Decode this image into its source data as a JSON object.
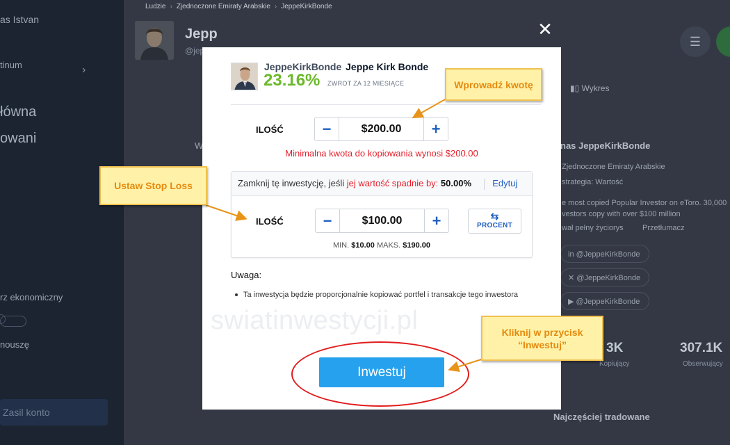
{
  "background": {
    "sidebar": {
      "user_name": "as Istvan",
      "club": "tinum",
      "menu_main": "łówna",
      "menu_watch": "owani",
      "economic": "rz ekonomiczny",
      "invite": "nouszę",
      "deposit_button": "Zasil konto"
    },
    "breadcrumb": [
      "Ludzie",
      "Zjednoczone Emiraty Arabskie",
      "JeppeKirkBonde"
    ],
    "profile_name": "Jepp",
    "profile_handle": "@jep",
    "left_card_letter": "W",
    "chart_tab": "Wykres",
    "right_panel": {
      "title": "nas JeppeKirkBonde",
      "country": "Zjednoczone Emiraty Arabskie",
      "strategy": "strategia: Wartość",
      "bio_1": "e most copied Popular Investor on eToro. 30,000",
      "bio_2": "vestors copy with over $100 million",
      "links": "wał pełny życiorys",
      "links_2": "Przetłumacz",
      "social": [
        "@JeppeKirkBonde",
        "@JeppeKirkBonde",
        "@JeppeKirkBonde"
      ]
    },
    "stats": [
      {
        "value": "3K",
        "label": "Kopiujący"
      },
      {
        "value": "307.1K",
        "label": "Obserwujący"
      }
    ],
    "bottom_title": "Najczęściej tradowane"
  },
  "modal": {
    "close_icon": "close-icon",
    "investor_handle": "JeppeKirkBonde",
    "investor_name": "Jeppe Kirk Bonde",
    "return_value": "23.16%",
    "return_label": "ZWROT ZA 12 MIESIĄCE",
    "amount_label": "ILOŚĆ",
    "amount_value": "$200.00",
    "min_warning": "Minimalna kwota do kopiowania wynosi $200.00",
    "stop_loss": {
      "text_prefix": "Zamknij tę inwestycję, jeśli",
      "text_red": "jej wartość spadnie by:",
      "percent": "50.00%",
      "edit_link": "Edytuj",
      "amount_label": "ILOŚĆ",
      "amount_value": "$100.00",
      "mode_button": "PROCENT",
      "min_label": "MIN.",
      "min_value": "$10.00",
      "max_label": "MAKS.",
      "max_value": "$190.00"
    },
    "note_title": "Uwaga:",
    "note_item": "Ta inwestycja będzie proporcjonalnie kopiować portfel i transakcje tego inwestora",
    "watermark": "swiatinwestycji.pl",
    "invest_button": "Inwestuj"
  },
  "annotations": {
    "enter_amount": "Wprowadź kwotę",
    "set_stop_loss": "Ustaw Stop Loss",
    "click_invest_line1": "Kliknij w przycisk",
    "click_invest_line2": "“Inwestuj”",
    "callout_color": "#fff2a8",
    "arrow_color": "#e8931a",
    "ellipse_color": "#e11d1d"
  }
}
